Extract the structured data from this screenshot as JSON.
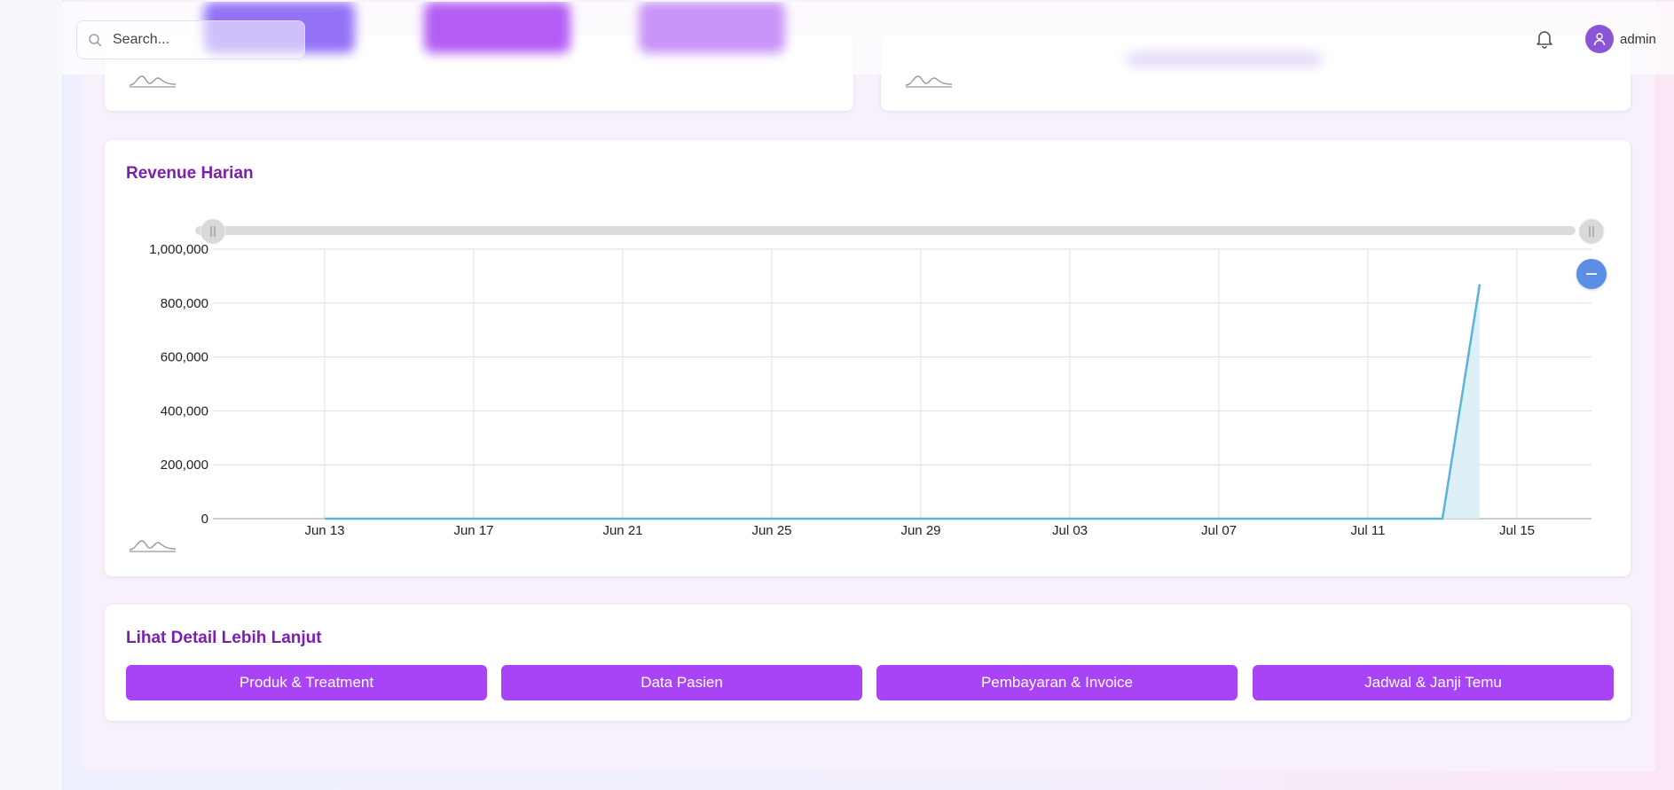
{
  "header": {
    "search_placeholder": "Search...",
    "username": "admin",
    "icons": {
      "search": "search-icon",
      "bell": "bell-icon",
      "user": "user-icon"
    }
  },
  "revenue_card": {
    "title": "Revenue Harian"
  },
  "detail_card": {
    "title": "Lihat Detail Lebih Lanjut",
    "buttons": [
      "Produk & Treatment",
      "Data Pasien",
      "Pembayaran & Invoice",
      "Jadwal & Janji Temu"
    ]
  },
  "colors": {
    "accent": "#a844f5",
    "title": "#7a1fb0",
    "line": "#5bb3d8",
    "area": "#d8edf6"
  },
  "chart_data": {
    "type": "area",
    "title": "Revenue Harian",
    "xlabel": "",
    "ylabel": "",
    "x_tick_labels": [
      "Jun 13",
      "Jun 17",
      "Jun 21",
      "Jun 25",
      "Jun 29",
      "Jul 03",
      "Jul 07",
      "Jul 11",
      "Jul 15"
    ],
    "y_tick_labels": [
      "0",
      "200,000",
      "400,000",
      "600,000",
      "800,000",
      "1,000,000"
    ],
    "ylim": [
      0,
      1000000
    ],
    "xlim": [
      "2025-06-10",
      "2025-07-17"
    ],
    "grid": true,
    "series": [
      {
        "x": [
          "2025-06-13",
          "2025-06-20",
          "2025-06-27",
          "2025-07-04",
          "2025-07-11",
          "2025-07-12",
          "2025-07-13",
          "2025-07-14"
        ],
        "y": [
          0,
          0,
          0,
          0,
          0,
          0,
          0,
          870000
        ]
      }
    ]
  }
}
